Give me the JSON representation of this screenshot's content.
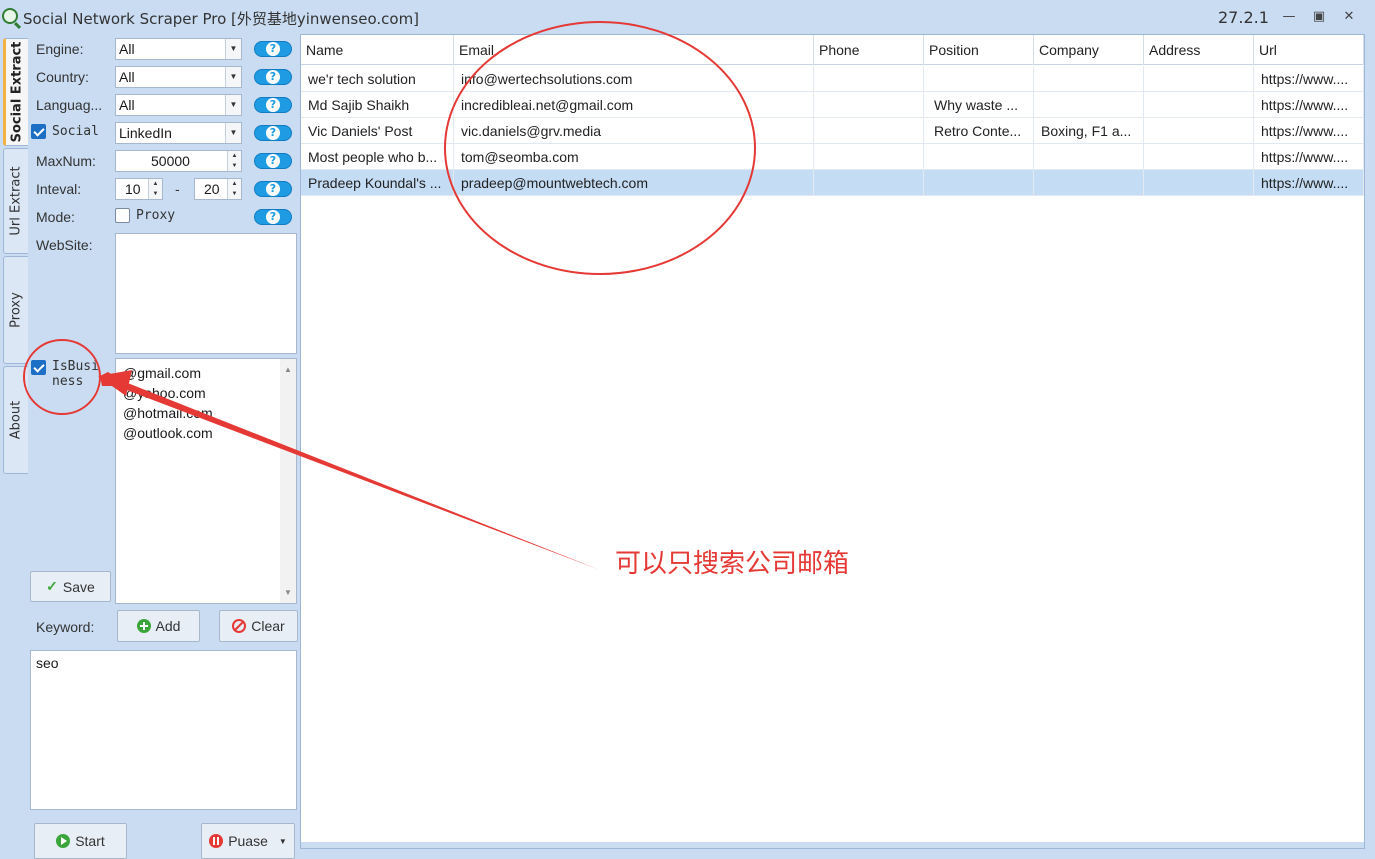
{
  "window": {
    "title": "Social Network Scraper Pro [外贸基地yinwenseo.com]",
    "version": "27.2.1"
  },
  "tabs": [
    "Social Extract",
    "Url Extract",
    "Proxy",
    "About"
  ],
  "form": {
    "engine_label": "Engine:",
    "engine_value": "All",
    "country_label": "Country:",
    "country_value": "All",
    "language_label": "Languag...",
    "language_value": "All",
    "social_label": "Social",
    "social_checked": true,
    "social_value": "LinkedIn",
    "maxnum_label": "MaxNum:",
    "maxnum_value": "50000",
    "interval_label": "Inteval:",
    "interval_min": "10",
    "interval_sep": "-",
    "interval_max": "20",
    "mode_label": "Mode:",
    "proxy_label": "Proxy",
    "proxy_checked": false,
    "website_label": "WebSite:",
    "website_value": "",
    "isbusiness_label_1": "IsBusi",
    "isbusiness_label_2": "ness",
    "isbusiness_checked": true,
    "domains": [
      "@gmail.com",
      "@yahoo.com",
      "@hotmail.com",
      "@outlook.com"
    ],
    "save_label": "Save",
    "keyword_label": "Keyword:",
    "add_label": "Add",
    "clear_label": "Clear",
    "keyword_value": "seo",
    "start_label": "Start",
    "pause_label": "Puase",
    "help_icon_text": "?"
  },
  "grid": {
    "columns": [
      "Name",
      "Email",
      "Phone",
      "Position",
      "Company",
      "Address",
      "Url"
    ],
    "rows": [
      {
        "name": "we'r tech solution",
        "email": "info@wertechsolutions.com",
        "phone": "",
        "position": "",
        "company": "",
        "address": "",
        "url": "https://www...."
      },
      {
        "name": "Md Sajib Shaikh",
        "email": "incredibleai.net@gmail.com",
        "phone": "",
        "position": "Why waste ...",
        "company": "",
        "address": "",
        "url": "https://www...."
      },
      {
        "name": "Vic Daniels' Post",
        "email": "vic.daniels@grv.media",
        "phone": "",
        "position": "Retro Conte...",
        "company": "Boxing, F1 a...",
        "address": "",
        "url": "https://www...."
      },
      {
        "name": "Most people who b...",
        "email": "tom@seomba.com",
        "phone": "",
        "position": "",
        "company": "",
        "address": "",
        "url": "https://www...."
      },
      {
        "name": "Pradeep Koundal's ...",
        "email": "pradeep@mountwebtech.com",
        "phone": "",
        "position": "",
        "company": "",
        "address": "",
        "url": "https://www...."
      }
    ],
    "selected_row": 4
  },
  "annotation": {
    "text": "可以只搜索公司邮箱",
    "color": "#e53935"
  },
  "colors": {
    "accent": "#1e9be3",
    "selection": "#c4dcf4",
    "window_bg": "#c9dcf2"
  }
}
